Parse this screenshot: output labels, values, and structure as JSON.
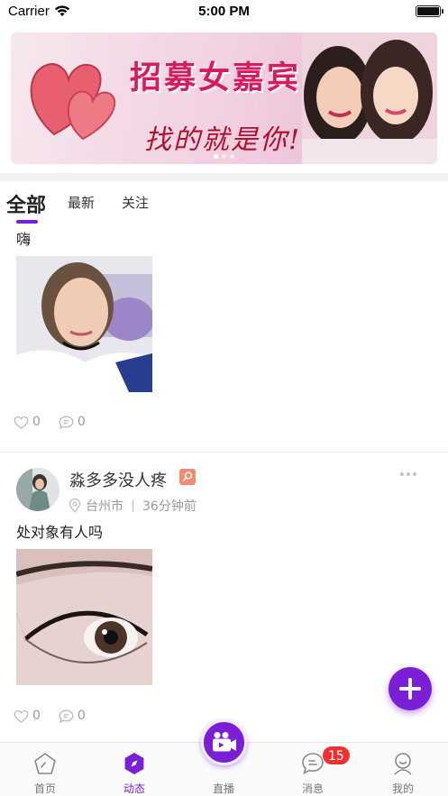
{
  "status_bar": {
    "carrier": "Carrier",
    "time": "5:00 PM"
  },
  "banner": {
    "title": "招募女嘉宾",
    "subtitle": "找的就是你!"
  },
  "tabs": [
    {
      "label": "全部",
      "active": true
    },
    {
      "label": "最新",
      "active": false
    },
    {
      "label": "关注",
      "active": false
    }
  ],
  "posts": [
    {
      "text": "嗨",
      "likes": "0",
      "comments": "0"
    },
    {
      "username": "淼多多没人疼",
      "location": "台州市",
      "time_ago": "36分钟前",
      "text": "处对象有人吗",
      "likes": "0",
      "comments": "0"
    }
  ],
  "tabbar": {
    "items": [
      {
        "label": "首页",
        "icon": "home-icon"
      },
      {
        "label": "动态",
        "icon": "compass-icon",
        "active": true
      },
      {
        "label": "直播",
        "icon": "video-camera-icon"
      },
      {
        "label": "消息",
        "icon": "chat-bubble-icon",
        "badge": "15"
      },
      {
        "label": "我的",
        "icon": "profile-icon"
      }
    ]
  },
  "colors": {
    "accent": "#7a1fd6",
    "badge": "#f0302f",
    "banner_title": "#d81b60"
  }
}
